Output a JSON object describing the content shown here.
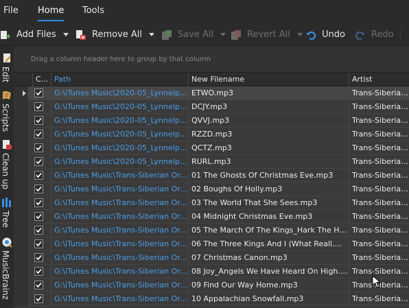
{
  "menu": {
    "file": "File",
    "home": "Home",
    "tools": "Tools"
  },
  "toolbar": {
    "add_files": "Add Files",
    "remove_all": "Remove All",
    "save_all": "Save All",
    "revert_all": "Revert All",
    "undo": "Undo",
    "redo": "Redo"
  },
  "sidebar": {
    "edit": "Edit",
    "scripts": "Scripts",
    "clean_up": "Clean up",
    "tree": "Tree",
    "musicbrainz": "MusicBrainz"
  },
  "grid": {
    "group_hint": "Drag a column header here to group by that column",
    "columns": {
      "check": "C...",
      "path": "Path",
      "new_filename": "New Filename",
      "artist": "Artist"
    },
    "rows": [
      {
        "path": "G:\\iTunes Music\\2020-05_Lynnelpo...",
        "new_filename": "ETWO.mp3",
        "artist": "Trans-Siberian O"
      },
      {
        "path": "G:\\iTunes Music\\2020-05_Lynnelpo...",
        "new_filename": "DCJY.mp3",
        "artist": "Trans-Siberian O"
      },
      {
        "path": "G:\\iTunes Music\\2020-05_Lynnelpo...",
        "new_filename": "QVVJ.mp3",
        "artist": "Trans-Siberian O"
      },
      {
        "path": "G:\\iTunes Music\\2020-05_Lynnelpo...",
        "new_filename": "RZZD.mp3",
        "artist": "Trans-Siberian O"
      },
      {
        "path": "G:\\iTunes Music\\2020-05_Lynnelpo...",
        "new_filename": "QCTZ.mp3",
        "artist": "Trans-Siberian O"
      },
      {
        "path": "G:\\iTunes Music\\2020-05_Lynnelpo...",
        "new_filename": "RURL.mp3",
        "artist": "Trans-Siberian O"
      },
      {
        "path": "G:\\iTunes Music\\Trans-Siberian Orc...",
        "new_filename": "01 The Ghosts Of Christmas Eve.mp3",
        "artist": "Trans-Siberian O"
      },
      {
        "path": "G:\\iTunes Music\\Trans-Siberian Orc...",
        "new_filename": "02 Boughs Of Holly.mp3",
        "artist": "Trans-Siberian O"
      },
      {
        "path": "G:\\iTunes Music\\Trans-Siberian Orc...",
        "new_filename": "03 The World That She Sees.mp3",
        "artist": "Trans-Siberian O"
      },
      {
        "path": "G:\\iTunes Music\\Trans-Siberian Orc...",
        "new_filename": "04 Midnight Christmas Eve.mp3",
        "artist": "Trans-Siberian O"
      },
      {
        "path": "G:\\iTunes Music\\Trans-Siberian Orc...",
        "new_filename": "05 The March Of The Kings_Hark The H.m...",
        "artist": "Trans-Siberian O"
      },
      {
        "path": "G:\\iTunes Music\\Trans-Siberian Orc...",
        "new_filename": "06 The Three Kings And I (What Reall.mp3",
        "artist": "Trans-Siberian O"
      },
      {
        "path": "G:\\iTunes Music\\Trans-Siberian Orc...",
        "new_filename": "07 Christmas Canon.mp3",
        "artist": "Trans-Siberian O"
      },
      {
        "path": "G:\\iTunes Music\\Trans-Siberian Orc...",
        "new_filename": "08 Joy_Angels We Have Heard On High.m...",
        "artist": "Trans-Siberian O"
      },
      {
        "path": "G:\\iTunes Music\\Trans-Siberian Orc...",
        "new_filename": "09 Find Our Way Home.mp3",
        "artist": "Trans-Siberian O"
      },
      {
        "path": "G:\\iTunes Music\\Trans-Siberian Orc...",
        "new_filename": "10 Appalachian Snowfall.mp3",
        "artist": "Trans-Siberian O"
      }
    ]
  },
  "colors": {
    "accent": "#2f8fe6",
    "path_text": "#4a9ee8",
    "background": "#2b2b2b",
    "grid": "#3a3a3a"
  }
}
